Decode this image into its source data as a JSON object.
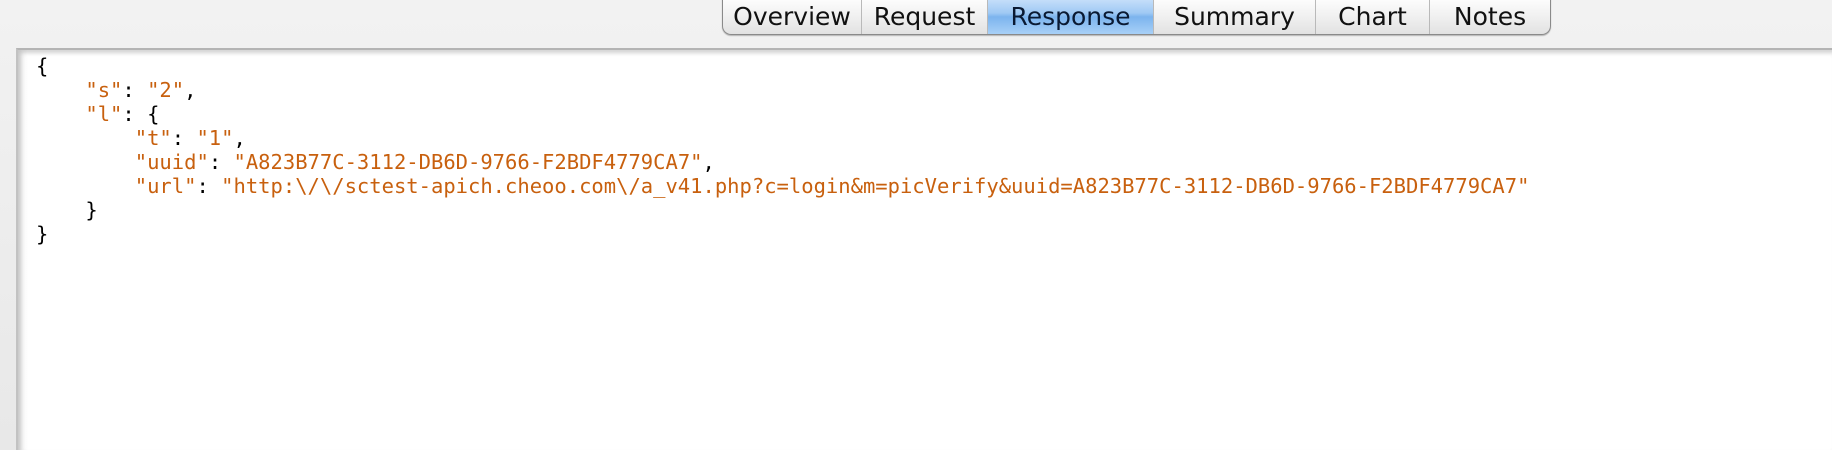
{
  "tabs": [
    {
      "label": "Overview",
      "active": false
    },
    {
      "label": "Request",
      "active": false
    },
    {
      "label": "Response",
      "active": true
    },
    {
      "label": "Summary",
      "active": false
    },
    {
      "label": "Chart",
      "active": false
    },
    {
      "label": "Notes",
      "active": false
    }
  ],
  "colors": {
    "string_color": "#c8600e",
    "active_tab": "#8cc0f2"
  },
  "json_view": {
    "s_key": "\"s\"",
    "s_value": "\"2\"",
    "l_key": "\"l\"",
    "t_key": "\"t\"",
    "t_value": "\"1\"",
    "uuid_key": "\"uuid\"",
    "uuid_value": "\"A823B77C-3112-DB6D-9766-F2BDF4779CA7\"",
    "url_key": "\"url\"",
    "url_value": "\"http:\\/\\/sctest-apich.cheoo.com\\/a_v41.php?c=login&m=picVerify&uuid=A823B77C-3112-DB6D-9766-F2BDF4779CA7\""
  }
}
